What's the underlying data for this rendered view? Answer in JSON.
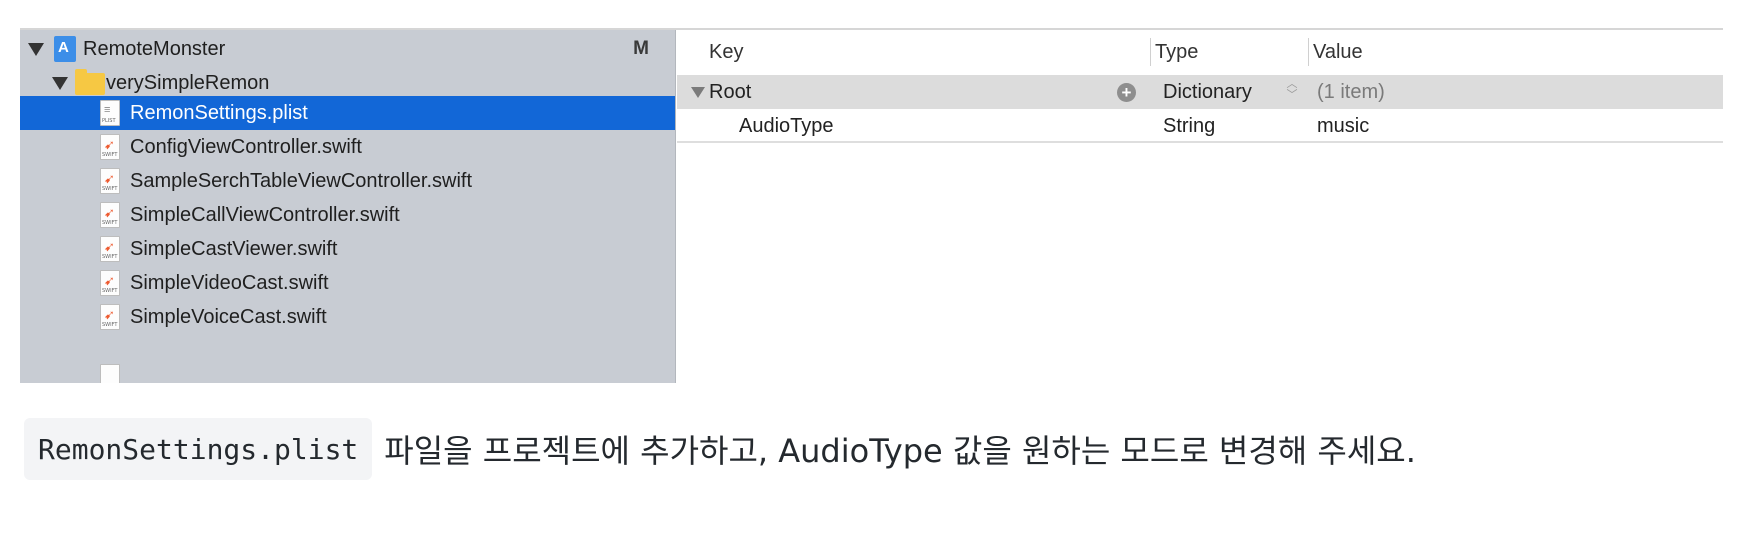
{
  "navigator": {
    "project": {
      "label": "RemoteMonster",
      "badge": "M"
    },
    "folder": {
      "label": "verySimpleRemon"
    },
    "files": [
      {
        "label": "RemonSettings.plist",
        "kind": "plist",
        "selected": true
      },
      {
        "label": "ConfigViewController.swift",
        "kind": "swift",
        "selected": false
      },
      {
        "label": "SampleSerchTableViewController.swift",
        "kind": "swift",
        "selected": false
      },
      {
        "label": "SimpleCallViewController.swift",
        "kind": "swift",
        "selected": false
      },
      {
        "label": "SimpleCastViewer.swift",
        "kind": "swift",
        "selected": false
      },
      {
        "label": "SimpleVideoCast.swift",
        "kind": "swift",
        "selected": false
      },
      {
        "label": "SimpleVoiceCast.swift",
        "kind": "swift",
        "selected": false
      }
    ],
    "selection_color": "#1267d7",
    "icons": {
      "project": "xcode-project-icon",
      "folder": "folder-icon",
      "swift": "swift-file-icon",
      "plist": "plist-file-icon"
    }
  },
  "editor": {
    "columns": {
      "key": "Key",
      "type": "Type",
      "value": "Value"
    },
    "root": {
      "key": "Root",
      "type": "Dictionary",
      "value": "(1 item)"
    },
    "entries": [
      {
        "key": "AudioType",
        "type": "String",
        "value": "music"
      }
    ]
  },
  "instruction": {
    "code": "RemonSettings.plist",
    "text": "파일을 프로젝트에 추가하고, AudioType 값을 원하는 모드로 변경해 주세요."
  }
}
